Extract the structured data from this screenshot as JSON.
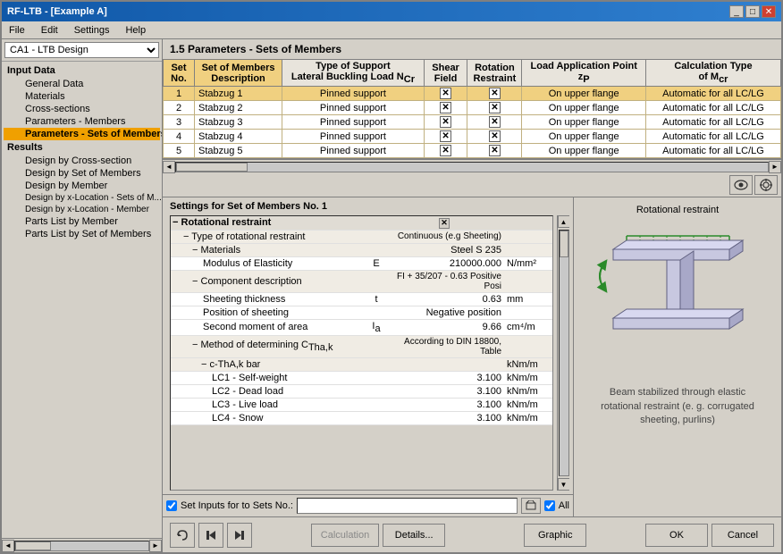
{
  "window": {
    "title": "RF-LTB - [Example A]",
    "close_btn": "✕"
  },
  "menubar": {
    "items": [
      "File",
      "Edit",
      "Settings",
      "Help"
    ]
  },
  "left_panel": {
    "dropdown_label": "CA1 - LTB Design",
    "sections": [
      {
        "label": "Input Data",
        "type": "section"
      },
      {
        "label": "General Data",
        "type": "item",
        "indent": 1
      },
      {
        "label": "Materials",
        "type": "item",
        "indent": 1
      },
      {
        "label": "Cross-sections",
        "type": "item",
        "indent": 1
      },
      {
        "label": "Parameters - Members",
        "type": "item",
        "indent": 1
      },
      {
        "label": "Parameters - Sets of Members",
        "type": "item",
        "indent": 1,
        "active": true
      },
      {
        "label": "Results",
        "type": "section"
      },
      {
        "label": "Design by Cross-section",
        "type": "item",
        "indent": 1
      },
      {
        "label": "Design by Set of Members",
        "type": "item",
        "indent": 1
      },
      {
        "label": "Design by Member",
        "type": "item",
        "indent": 1
      },
      {
        "label": "Design by x-Location - Sets of M...",
        "type": "item",
        "indent": 1
      },
      {
        "label": "Design by x-Location - Member",
        "type": "item",
        "indent": 1
      },
      {
        "label": "Parts List by Member",
        "type": "item",
        "indent": 1
      },
      {
        "label": "Parts List by Set of Members",
        "type": "item",
        "indent": 1
      }
    ]
  },
  "main": {
    "section_title": "1.5 Parameters - Sets of Members",
    "table": {
      "headers": [
        {
          "id": "set_no",
          "label": "Set\nNo.",
          "col": "A"
        },
        {
          "id": "description",
          "label": "Set of Members\nDescription",
          "col": "A"
        },
        {
          "id": "support_type",
          "label": "Type of Support\nLateral Buckling Load NCr",
          "col": "B"
        },
        {
          "id": "shear_field",
          "label": "Shear\nField",
          "col": "C"
        },
        {
          "id": "rotation_restraint",
          "label": "Rotation\nRestraint",
          "col": "D"
        },
        {
          "id": "load_app_point",
          "label": "Load Application Point\nzP",
          "col": "E"
        },
        {
          "id": "calc_type",
          "label": "Calculation Type\nof Mcr",
          "col": "F"
        }
      ],
      "rows": [
        {
          "no": "1",
          "name": "Stabzug 1",
          "support": "Pinned support",
          "shear": "✕",
          "rotation": "✕",
          "load_point": "On upper flange",
          "calc": "Automatic for all LC/LG",
          "selected": true
        },
        {
          "no": "2",
          "name": "Stabzug 2",
          "support": "Pinned support",
          "shear": "✕",
          "rotation": "✕",
          "load_point": "On upper flange",
          "calc": "Automatic for all LC/LG",
          "selected": false
        },
        {
          "no": "3",
          "name": "Stabzug 3",
          "support": "Pinned support",
          "shear": "✕",
          "rotation": "✕",
          "load_point": "On upper flange",
          "calc": "Automatic for all LC/LG",
          "selected": false
        },
        {
          "no": "4",
          "name": "Stabzug 4",
          "support": "Pinned support",
          "shear": "✕",
          "rotation": "✕",
          "load_point": "On upper flange",
          "calc": "Automatic for all LC/LG",
          "selected": false
        },
        {
          "no": "5",
          "name": "Stabzug 5",
          "support": "Pinned support",
          "shear": "✕",
          "rotation": "✕",
          "load_point": "On upper flange",
          "calc": "Automatic for all LC/LG",
          "selected": false
        }
      ]
    }
  },
  "settings": {
    "title": "Settings for Set of Members No. 1",
    "properties": [
      {
        "indent": 0,
        "expand": "−",
        "name": "Rotational restraint",
        "sym": "",
        "val": "",
        "unit": "",
        "close_x": true,
        "type": "header"
      },
      {
        "indent": 1,
        "expand": "−",
        "name": "Type of rotational restraint",
        "sym": "",
        "val": "Continuous (e.g Sheeting)",
        "unit": "",
        "type": "sub"
      },
      {
        "indent": 2,
        "expand": "−",
        "name": "Materials",
        "sym": "",
        "val": "Steel S 235",
        "unit": "",
        "type": "sub"
      },
      {
        "indent": 3,
        "expand": "",
        "name": "Modulus of Elasticity",
        "sym": "E",
        "val": "210000.000",
        "unit": "N/mm²",
        "type": "item"
      },
      {
        "indent": 2,
        "expand": "−",
        "name": "Component description",
        "sym": "",
        "val": "FI + 35/207 - 0.63 Positive Posi",
        "unit": "",
        "type": "sub"
      },
      {
        "indent": 3,
        "expand": "",
        "name": "Sheeting thickness",
        "sym": "t",
        "val": "0.63",
        "unit": "mm",
        "type": "item"
      },
      {
        "indent": 3,
        "expand": "",
        "name": "Position of sheeting",
        "sym": "",
        "val": "Negative position",
        "unit": "",
        "type": "item"
      },
      {
        "indent": 3,
        "expand": "",
        "name": "Second moment of area",
        "sym": "Ia",
        "val": "9.66",
        "unit": "cm⁴/m",
        "type": "item"
      },
      {
        "indent": 2,
        "expand": "−",
        "name": "Method of determining CTha,k",
        "sym": "",
        "val": "According to DIN 18800, Table",
        "unit": "",
        "type": "sub"
      },
      {
        "indent": 3,
        "expand": "−",
        "name": "c-ThA,k bar",
        "sym": "",
        "val": "",
        "unit": "kNm/m",
        "type": "sub"
      },
      {
        "indent": 4,
        "expand": "",
        "name": "LC1 - Self-weight",
        "sym": "",
        "val": "3.100",
        "unit": "kNm/m",
        "type": "item"
      },
      {
        "indent": 4,
        "expand": "",
        "name": "LC2 - Dead load",
        "sym": "",
        "val": "3.100",
        "unit": "kNm/m",
        "type": "item"
      },
      {
        "indent": 4,
        "expand": "",
        "name": "LC3 - Live load",
        "sym": "",
        "val": "3.100",
        "unit": "kNm/m",
        "type": "item"
      },
      {
        "indent": 4,
        "expand": "",
        "name": "LC4 - Snow",
        "sym": "",
        "val": "3.100",
        "unit": "kNm/m",
        "type": "item"
      }
    ],
    "set_inputs": {
      "checkbox_label": "Set Inputs for to Sets No.:",
      "all_checkbox": "All"
    }
  },
  "image_panel": {
    "title": "Rotational restraint",
    "caption": "Beam stabilized through elastic\nrotational restraint (e. g. corrugated\nsheeting, purlins)"
  },
  "bottom_buttons": {
    "nav": [
      "↩",
      "←",
      "→"
    ],
    "calculation": "Calculation",
    "details": "Details...",
    "graphic": "Graphic",
    "ok": "OK",
    "cancel": "Cancel"
  }
}
